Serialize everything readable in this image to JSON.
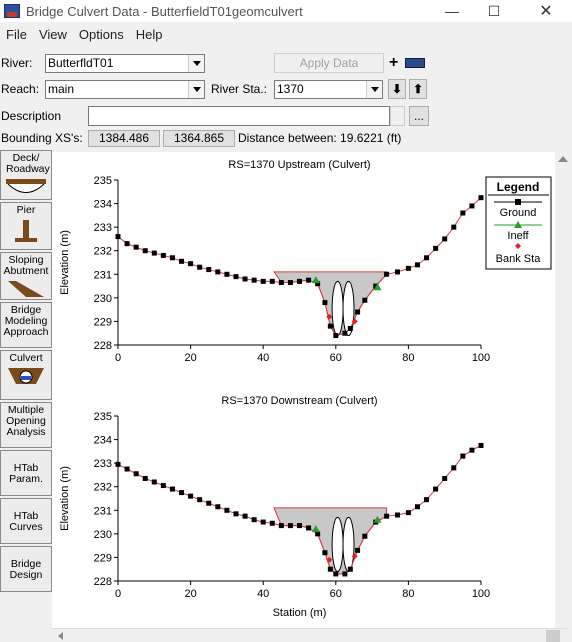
{
  "window": {
    "title": "Bridge Culvert Data - ButterfieldT01geomculvert"
  },
  "menu": [
    "File",
    "View",
    "Options",
    "Help"
  ],
  "river": {
    "label": "River:",
    "value": "ButterfldT01"
  },
  "apply_data_label": "Apply Data",
  "reach": {
    "label": "Reach:",
    "value": "main"
  },
  "river_sta": {
    "label": "River Sta.:",
    "value": "1370"
  },
  "description": {
    "label": "Description",
    "value": "",
    "ellipsis": "..."
  },
  "bounding": {
    "label": "Bounding XS's:",
    "upstream": "1384.486",
    "downstream": "1364.865",
    "distance_text": "Distance between: 19.6221 (ft)"
  },
  "sidebar": [
    {
      "id": "deck",
      "label": "Deck/ Roadway"
    },
    {
      "id": "pier",
      "label": "Pier"
    },
    {
      "id": "abutment",
      "label": "Sloping Abutment"
    },
    {
      "id": "modeling",
      "label": "Bridge Modeling Approach"
    },
    {
      "id": "culvert",
      "label": "Culvert"
    },
    {
      "id": "multiple",
      "label": "Multiple Opening Analysis"
    },
    {
      "id": "htab_param",
      "label": "HTab Param."
    },
    {
      "id": "htab_curves",
      "label": "HTab Curves"
    },
    {
      "id": "bridge_design",
      "label": "Bridge Design"
    }
  ],
  "legend": {
    "title": "Legend",
    "items": [
      "Ground",
      "Ineff",
      "Bank Sta"
    ]
  },
  "colors": {
    "ground": "#000000",
    "ground_line": "#d63a3a",
    "ineff": "#2a9d2a",
    "bank": "#e02020",
    "fill": "#c8c8c8"
  },
  "chart_data": [
    {
      "type": "line",
      "title": "RS=1370   Upstream  (Culvert)",
      "xlabel": "",
      "ylabel": "Elevation (m)",
      "xlim": [
        0,
        100
      ],
      "ylim": [
        228,
        235
      ],
      "xticks": [
        0,
        20,
        40,
        60,
        80,
        100
      ],
      "yticks": [
        228,
        229,
        230,
        231,
        232,
        233,
        234,
        235
      ],
      "series": [
        {
          "name": "Ground",
          "points": [
            [
              0,
              232.6
            ],
            [
              2.5,
              232.3
            ],
            [
              5,
              232.15
            ],
            [
              7.5,
              232.0
            ],
            [
              10,
              231.9
            ],
            [
              12.5,
              231.8
            ],
            [
              15,
              231.7
            ],
            [
              17.5,
              231.55
            ],
            [
              20,
              231.45
            ],
            [
              22.5,
              231.3
            ],
            [
              25,
              231.2
            ],
            [
              27.5,
              231.1
            ],
            [
              30,
              231.0
            ],
            [
              32.5,
              230.9
            ],
            [
              35,
              230.8
            ],
            [
              37.5,
              230.75
            ],
            [
              40,
              230.7
            ],
            [
              42.5,
              230.7
            ],
            [
              45,
              230.65
            ],
            [
              47.5,
              230.65
            ],
            [
              50,
              230.7
            ],
            [
              52.5,
              230.75
            ],
            [
              55,
              230.6
            ],
            [
              57,
              229.8
            ],
            [
              58.5,
              228.8
            ],
            [
              60,
              228.4
            ],
            [
              62.5,
              228.5
            ],
            [
              64,
              228.7
            ],
            [
              66,
              229.4
            ],
            [
              68,
              229.9
            ],
            [
              71,
              230.5
            ],
            [
              74,
              231.0
            ],
            [
              77,
              231.1
            ],
            [
              80,
              231.25
            ],
            [
              82.5,
              231.4
            ],
            [
              85,
              231.7
            ],
            [
              87.5,
              232.1
            ],
            [
              90,
              232.5
            ],
            [
              92.5,
              233.0
            ],
            [
              95,
              233.6
            ],
            [
              97.5,
              233.9
            ],
            [
              100,
              234.25
            ]
          ]
        },
        {
          "name": "Ineff",
          "points": [
            [
              54.5,
              230.75
            ],
            [
              71.5,
              230.45
            ]
          ]
        },
        {
          "name": "Bank Sta",
          "points": [
            [
              58.2,
              229.2
            ],
            [
              65.2,
              229.0
            ]
          ]
        }
      ],
      "ineff_top": 231.1
    },
    {
      "type": "line",
      "title": "RS=1370   Downstream  (Culvert)",
      "xlabel": "Station (m)",
      "ylabel": "Elevation (m)",
      "xlim": [
        0,
        100
      ],
      "ylim": [
        228,
        235
      ],
      "xticks": [
        0,
        20,
        40,
        60,
        80,
        100
      ],
      "yticks": [
        228,
        229,
        230,
        231,
        232,
        233,
        234,
        235
      ],
      "series": [
        {
          "name": "Ground",
          "points": [
            [
              0,
              232.95
            ],
            [
              2.5,
              232.75
            ],
            [
              5,
              232.55
            ],
            [
              7.5,
              232.35
            ],
            [
              10,
              232.2
            ],
            [
              12.5,
              232.05
            ],
            [
              15,
              231.9
            ],
            [
              17.5,
              231.75
            ],
            [
              20,
              231.6
            ],
            [
              22.5,
              231.45
            ],
            [
              25,
              231.3
            ],
            [
              27.5,
              231.15
            ],
            [
              30,
              231.0
            ],
            [
              32.5,
              230.85
            ],
            [
              35,
              230.75
            ],
            [
              37.5,
              230.6
            ],
            [
              40,
              230.5
            ],
            [
              42.5,
              230.45
            ],
            [
              45,
              230.35
            ],
            [
              47.5,
              230.35
            ],
            [
              50,
              230.35
            ],
            [
              52.5,
              230.25
            ],
            [
              55,
              230.0
            ],
            [
              57,
              229.2
            ],
            [
              58.5,
              228.5
            ],
            [
              60,
              228.3
            ],
            [
              62.5,
              228.3
            ],
            [
              64,
              228.5
            ],
            [
              66,
              229.3
            ],
            [
              68,
              229.9
            ],
            [
              71,
              230.5
            ],
            [
              74,
              230.75
            ],
            [
              77,
              230.8
            ],
            [
              80,
              230.9
            ],
            [
              82.5,
              231.15
            ],
            [
              85,
              231.45
            ],
            [
              87.5,
              231.9
            ],
            [
              90,
              232.35
            ],
            [
              92.5,
              232.8
            ],
            [
              95,
              233.3
            ],
            [
              97.5,
              233.55
            ],
            [
              100,
              233.75
            ]
          ]
        },
        {
          "name": "Ineff",
          "points": [
            [
              54.5,
              230.2
            ],
            [
              71.5,
              230.6
            ]
          ]
        },
        {
          "name": "Bank Sta",
          "points": [
            [
              58.2,
              228.9
            ],
            [
              65.2,
              229.05
            ]
          ]
        }
      ],
      "ineff_top": 231.1
    }
  ]
}
